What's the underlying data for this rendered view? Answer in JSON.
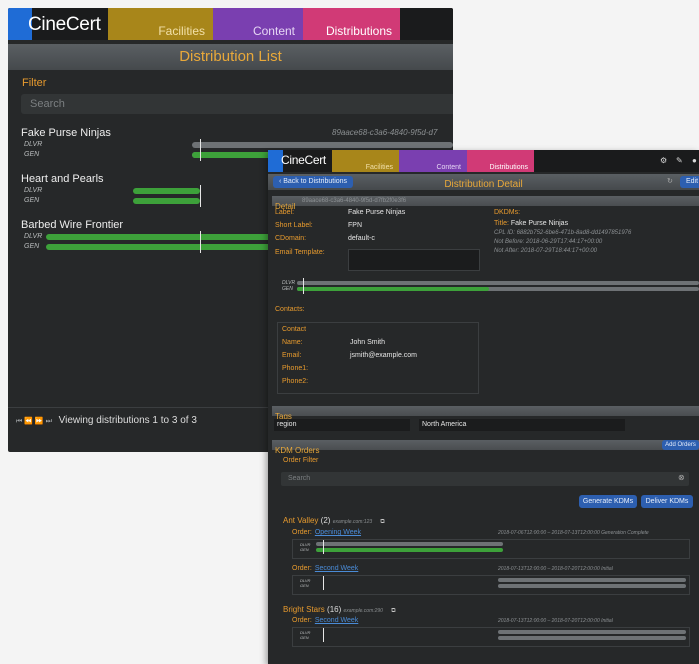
{
  "back_window": {
    "logo": "CineCert",
    "nav": [
      "Facilities",
      "Content",
      "Distributions"
    ],
    "title": "Distribution List",
    "filter_label": "Filter",
    "search_placeholder": "Search",
    "rows": [
      {
        "name": "Fake Purse Ninjas",
        "uuid": "89aace68-c3a6-4840-9f5d-d7"
      },
      {
        "name": "Heart and Pearls",
        "uuid": ""
      },
      {
        "name": "Barbed Wire Frontier",
        "uuid": ""
      }
    ],
    "row_labels": {
      "dlvr": "DLVR",
      "gen": "GEN"
    },
    "pager_arrows": "⏮ ⏪ ⏩ ⏭",
    "pager": "Viewing distributions 1 to 3 of 3"
  },
  "front_window": {
    "logo": "CineCert",
    "nav": [
      "Facilities",
      "Content",
      "Distributions"
    ],
    "back_button": "‹ Back to Distributions",
    "title": "Distribution Detail",
    "edit_button": "Edit",
    "detail": {
      "section": "Detail",
      "section_uuid": "89aace68-c3a6-4840-9f5d-d7fb2f0e3f6",
      "label_key": "Label:",
      "label_val": "Fake Purse Ninjas",
      "short_key": "Short Label:",
      "short_val": "FPN",
      "cdomain_key": "CDomain:",
      "cdomain_val": "default-c",
      "email_key": "Email Template:",
      "dkdms_key": "DKDMs:",
      "title_key": "Title:",
      "title_val": "Fake Purse Ninjas",
      "cpl_id": "CPL ID: 6882b752-6be6-471b-8ad8-dd1497851976",
      "not_before": "Not Before:  2018-06-29T17:44:17+00:00",
      "not_after": "Not After:   2018-07-29T18:44:17+00:00",
      "bar_labels": {
        "dlvr": "DLVR",
        "gen": "GEN"
      }
    },
    "contacts": {
      "title": "Contacts:",
      "box_title": "Contact",
      "name_key": "Name:",
      "name_val": "John Smith",
      "email_key": "Email:",
      "email_val": "jsmith@example.com",
      "phone1_key": "Phone1:",
      "phone2_key": "Phone2:"
    },
    "tags": {
      "section": "Tags",
      "key": "region",
      "value": "North America"
    },
    "kdm_orders": {
      "section": "KDM Orders",
      "add_button": "Add Orders",
      "filter_label": "Order Filter",
      "search_placeholder": "Search",
      "generate_button": "Generate KDMs",
      "deliver_button": "Deliver KDMs",
      "groups": [
        {
          "name": "Ant Valley",
          "count": "(2)",
          "host": "example.com:123",
          "orders": [
            {
              "label": "Order:",
              "link": "Opening Week",
              "dates": "2018-07-06T12:00:00 – 2018-07-13T12:00:00 Generation Complete"
            },
            {
              "label": "Order:",
              "link": "Second Week",
              "dates": "2018-07-13T12:00:00 – 2018-07-20T12:00:00 Initial"
            }
          ]
        },
        {
          "name": "Bright Stars",
          "count": "(16)",
          "host": "example.com:290",
          "orders": [
            {
              "label": "Order:",
              "link": "Second Week",
              "dates": "2018-07-13T12:00:00 – 2018-07-20T12:00:00 Initial"
            }
          ]
        }
      ]
    }
  },
  "colors": {
    "accent": "#e89b2e",
    "green": "#3da13a",
    "blue": "#2d5fb0",
    "facilities": "#a8861a",
    "content": "#7a3fb0",
    "distributions": "#d13a76"
  }
}
